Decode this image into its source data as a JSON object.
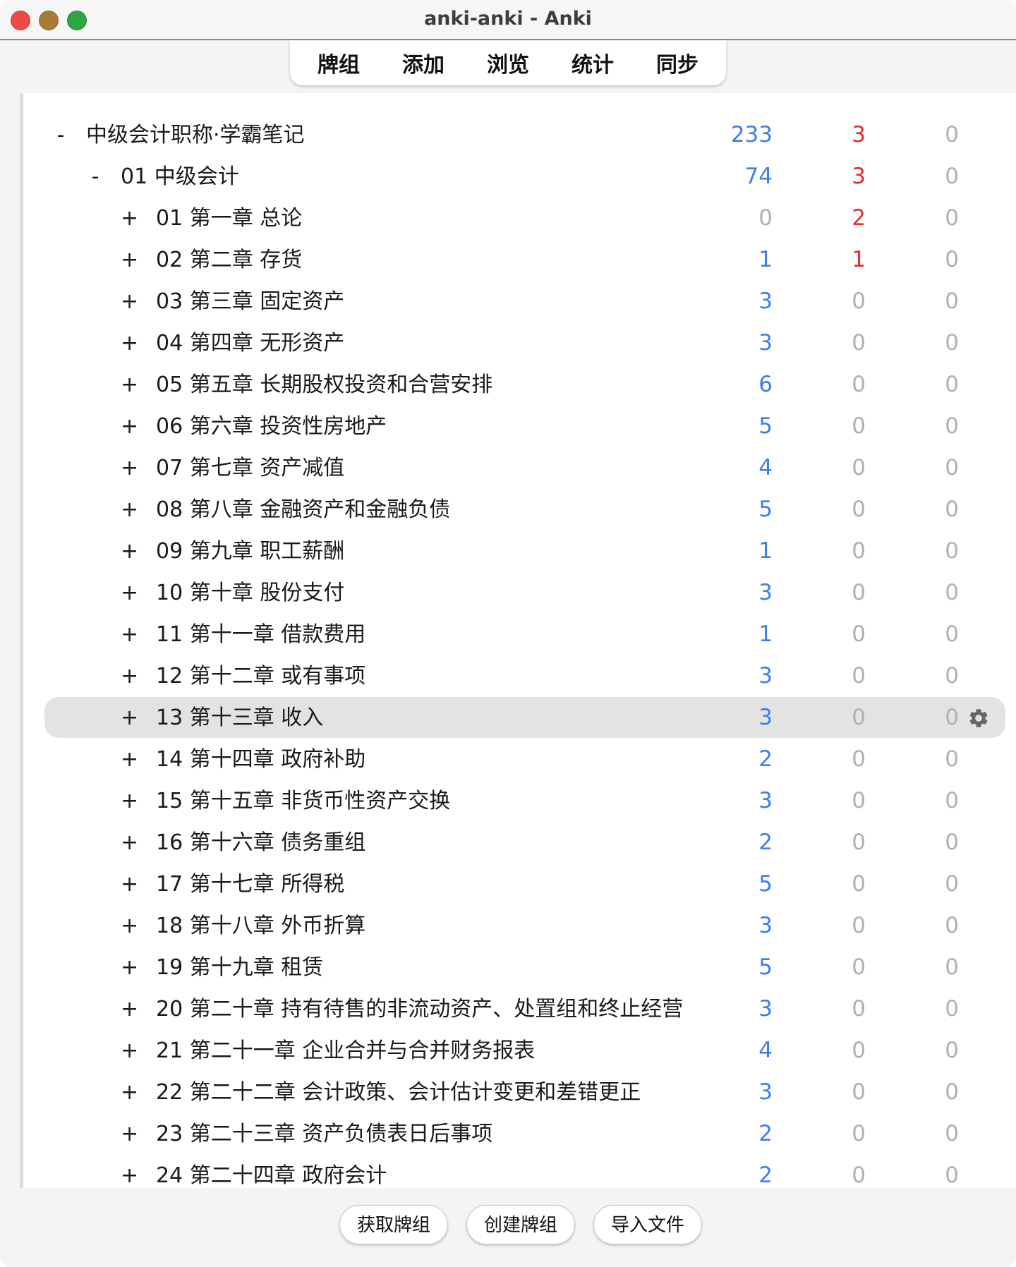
{
  "window": {
    "title": "anki-anki - Anki"
  },
  "toolbar": {
    "items": [
      "牌组",
      "添加",
      "浏览",
      "统计",
      "同步"
    ]
  },
  "colors": {
    "new": "#3c7df0",
    "learn": "#e32b2b",
    "zero": "#b0b0b0",
    "current_row": "#e3e3e3"
  },
  "decks": [
    {
      "toggle": "-",
      "name": "中级会计职称·学霸笔记",
      "level": 0,
      "new": "233",
      "learn": "3",
      "due": "0"
    },
    {
      "toggle": "-",
      "name": "01 中级会计",
      "level": 1,
      "new": "74",
      "learn": "3",
      "due": "0"
    },
    {
      "toggle": "+",
      "name": "01 第一章 总论",
      "level": 2,
      "new": "0",
      "learn": "2",
      "due": "0"
    },
    {
      "toggle": "+",
      "name": "02 第二章 存货",
      "level": 2,
      "new": "1",
      "learn": "1",
      "due": "0"
    },
    {
      "toggle": "+",
      "name": "03 第三章 固定资产",
      "level": 2,
      "new": "3",
      "learn": "0",
      "due": "0"
    },
    {
      "toggle": "+",
      "name": "04 第四章 无形资产",
      "level": 2,
      "new": "3",
      "learn": "0",
      "due": "0"
    },
    {
      "toggle": "+",
      "name": "05 第五章 长期股权投资和合营安排",
      "level": 2,
      "new": "6",
      "learn": "0",
      "due": "0"
    },
    {
      "toggle": "+",
      "name": "06 第六章 投资性房地产",
      "level": 2,
      "new": "5",
      "learn": "0",
      "due": "0"
    },
    {
      "toggle": "+",
      "name": "07 第七章 资产减值",
      "level": 2,
      "new": "4",
      "learn": "0",
      "due": "0"
    },
    {
      "toggle": "+",
      "name": "08 第八章 金融资产和金融负债",
      "level": 2,
      "new": "5",
      "learn": "0",
      "due": "0"
    },
    {
      "toggle": "+",
      "name": "09 第九章 职工薪酬",
      "level": 2,
      "new": "1",
      "learn": "0",
      "due": "0"
    },
    {
      "toggle": "+",
      "name": "10 第十章 股份支付",
      "level": 2,
      "new": "3",
      "learn": "0",
      "due": "0"
    },
    {
      "toggle": "+",
      "name": "11 第十一章 借款费用",
      "level": 2,
      "new": "1",
      "learn": "0",
      "due": "0"
    },
    {
      "toggle": "+",
      "name": "12 第十二章 或有事项",
      "level": 2,
      "new": "3",
      "learn": "0",
      "due": "0"
    },
    {
      "toggle": "+",
      "name": "13 第十三章 收入",
      "level": 2,
      "new": "3",
      "learn": "0",
      "due": "0",
      "current": true
    },
    {
      "toggle": "+",
      "name": "14 第十四章 政府补助",
      "level": 2,
      "new": "2",
      "learn": "0",
      "due": "0"
    },
    {
      "toggle": "+",
      "name": "15 第十五章 非货币性资产交换",
      "level": 2,
      "new": "3",
      "learn": "0",
      "due": "0"
    },
    {
      "toggle": "+",
      "name": "16 第十六章 债务重组",
      "level": 2,
      "new": "2",
      "learn": "0",
      "due": "0"
    },
    {
      "toggle": "+",
      "name": "17 第十七章 所得税",
      "level": 2,
      "new": "5",
      "learn": "0",
      "due": "0"
    },
    {
      "toggle": "+",
      "name": "18 第十八章 外币折算",
      "level": 2,
      "new": "3",
      "learn": "0",
      "due": "0"
    },
    {
      "toggle": "+",
      "name": "19 第十九章 租赁",
      "level": 2,
      "new": "5",
      "learn": "0",
      "due": "0"
    },
    {
      "toggle": "+",
      "name": "20 第二十章 持有待售的非流动资产、处置组和终止经营",
      "level": 2,
      "new": "3",
      "learn": "0",
      "due": "0"
    },
    {
      "toggle": "+",
      "name": "21 第二十一章 企业合并与合并财务报表",
      "level": 2,
      "new": "4",
      "learn": "0",
      "due": "0"
    },
    {
      "toggle": "+",
      "name": "22 第二十二章 会计政策、会计估计变更和差错更正",
      "level": 2,
      "new": "3",
      "learn": "0",
      "due": "0"
    },
    {
      "toggle": "+",
      "name": "23 第二十三章 资产负债表日后事项",
      "level": 2,
      "new": "2",
      "learn": "0",
      "due": "0"
    },
    {
      "toggle": "+",
      "name": "24 第二十四章 政府会计",
      "level": 2,
      "new": "2",
      "learn": "0",
      "due": "0"
    }
  ],
  "footer": {
    "get_shared": "获取牌组",
    "create_deck": "创建牌组",
    "import_file": "导入文件"
  },
  "icons": {
    "options": "gear-icon"
  }
}
